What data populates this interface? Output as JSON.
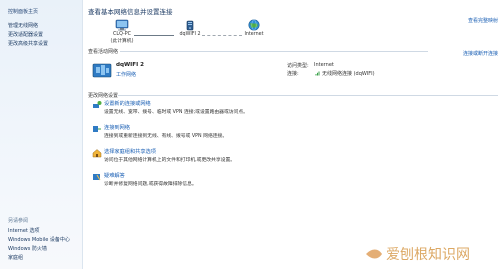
{
  "sidebar": {
    "items": [
      "控制面板主页",
      "管理无线网络",
      "更改适配器设置",
      "更改高级共享设置"
    ],
    "see_also": "另请参阅",
    "bottom_items": [
      "Internet 选项",
      "Windows Mobile 设备中心",
      "Windows 防火墙",
      "家庭组"
    ]
  },
  "main": {
    "title": "查看基本网络信息并设置连接",
    "view_full_map": "查看完整映射",
    "nodes": [
      {
        "line1": "CLQ-PC",
        "line2": "(此计算机)"
      },
      {
        "line1": "dqWIFI 2",
        "line2": ""
      },
      {
        "line1": "Internet",
        "line2": ""
      }
    ],
    "active_section": "查看活动网络",
    "connect_disconnect": "连接或断开连接",
    "network_name": "dqWIFI 2",
    "network_type": "工作网络",
    "access_type_label": "访问类型:",
    "access_type_value": "Internet",
    "connection_label": "连接:",
    "connection_value": "无线网络连接 (dqWIFI)",
    "change_section": "更改网络设置",
    "tasks": [
      {
        "title": "设置新的连接或网络",
        "desc": "设置无线、宽带、拨号、临时或 VPN 连接;或设置路由器或访问点。"
      },
      {
        "title": "连接到网络",
        "desc": "连接到或重新连接到无线、有线、拨号或 VPN 网络连接。"
      },
      {
        "title": "选择家庭组和共享选项",
        "desc": "访问位于其他网络计算机上的文件和打印机,或更改共享设置。"
      },
      {
        "title": "疑难解答",
        "desc": "诊断并修复网络问题,或获得故障排除信息。"
      }
    ]
  },
  "colors": {
    "accent": "#1a5fb4",
    "sidebar_bg": "#e9f1f9"
  },
  "icons": [
    "computer-icon",
    "router-icon",
    "globe-icon",
    "wifi-signal-icon",
    "network-setup-icon",
    "connect-network-icon",
    "homegroup-icon",
    "troubleshoot-icon",
    "folder-icon"
  ],
  "watermark": {
    "text": "爱刨根知识网"
  }
}
